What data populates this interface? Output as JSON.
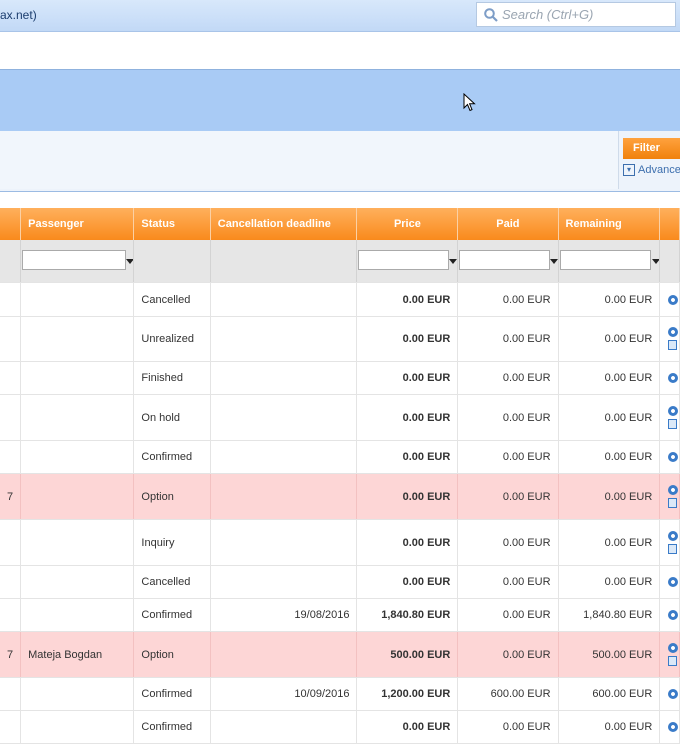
{
  "window": {
    "title_fragment": "ax.net)"
  },
  "search": {
    "placeholder": "Search (Ctrl+G)"
  },
  "filter_panel": {
    "filter_button": "Filter",
    "advanced_label": "Advance"
  },
  "columns": [
    {
      "label": ""
    },
    {
      "label": "Passenger"
    },
    {
      "label": "Status"
    },
    {
      "label": "Cancellation deadline"
    },
    {
      "label": "Price"
    },
    {
      "label": "Paid"
    },
    {
      "label": "Remaining"
    },
    {
      "label": ""
    }
  ],
  "rows": [
    {
      "first": "",
      "passenger": "",
      "status": "Cancelled",
      "deadline": "",
      "price": "0.00 EUR",
      "paid": "0.00 EUR",
      "remaining": "0.00 EUR"
    },
    {
      "first": "",
      "passenger": "",
      "status": "Unrealized",
      "deadline": "",
      "price": "0.00 EUR",
      "paid": "0.00 EUR",
      "remaining": "0.00 EUR"
    },
    {
      "first": "",
      "passenger": "",
      "status": "Finished",
      "deadline": "",
      "price": "0.00 EUR",
      "paid": "0.00 EUR",
      "remaining": "0.00 EUR"
    },
    {
      "first": "",
      "passenger": "",
      "status": "On hold",
      "deadline": "",
      "price": "0.00 EUR",
      "paid": "0.00 EUR",
      "remaining": "0.00 EUR"
    },
    {
      "first": "",
      "passenger": "",
      "status": "Confirmed",
      "deadline": "",
      "price": "0.00 EUR",
      "paid": "0.00 EUR",
      "remaining": "0.00 EUR"
    },
    {
      "first": "7",
      "passenger": "",
      "status": "Option",
      "deadline": "",
      "price": "0.00 EUR",
      "paid": "0.00 EUR",
      "remaining": "0.00 EUR"
    },
    {
      "first": "",
      "passenger": "",
      "status": "Inquiry",
      "deadline": "",
      "price": "0.00 EUR",
      "paid": "0.00 EUR",
      "remaining": "0.00 EUR"
    },
    {
      "first": "",
      "passenger": "",
      "status": "Cancelled",
      "deadline": "",
      "price": "0.00 EUR",
      "paid": "0.00 EUR",
      "remaining": "0.00 EUR"
    },
    {
      "first": "",
      "passenger": "",
      "status": "Confirmed",
      "deadline": "19/08/2016",
      "price": "1,840.80 EUR",
      "paid": "0.00 EUR",
      "remaining": "1,840.80 EUR"
    },
    {
      "first": "7",
      "passenger": "Mateja Bogdan",
      "status": "Option",
      "deadline": "",
      "price": "500.00 EUR",
      "paid": "0.00 EUR",
      "remaining": "500.00 EUR"
    },
    {
      "first": "",
      "passenger": "",
      "status": "Confirmed",
      "deadline": "10/09/2016",
      "price": "1,200.00 EUR",
      "paid": "600.00 EUR",
      "remaining": "600.00 EUR"
    },
    {
      "first": "",
      "passenger": "",
      "status": "Confirmed",
      "deadline": "",
      "price": "0.00 EUR",
      "paid": "0.00 EUR",
      "remaining": "0.00 EUR"
    }
  ],
  "colors": {
    "header_orange": "#f98a1c",
    "highlight_row": "#fdd6d6",
    "band_blue": "#a9cbf5"
  }
}
